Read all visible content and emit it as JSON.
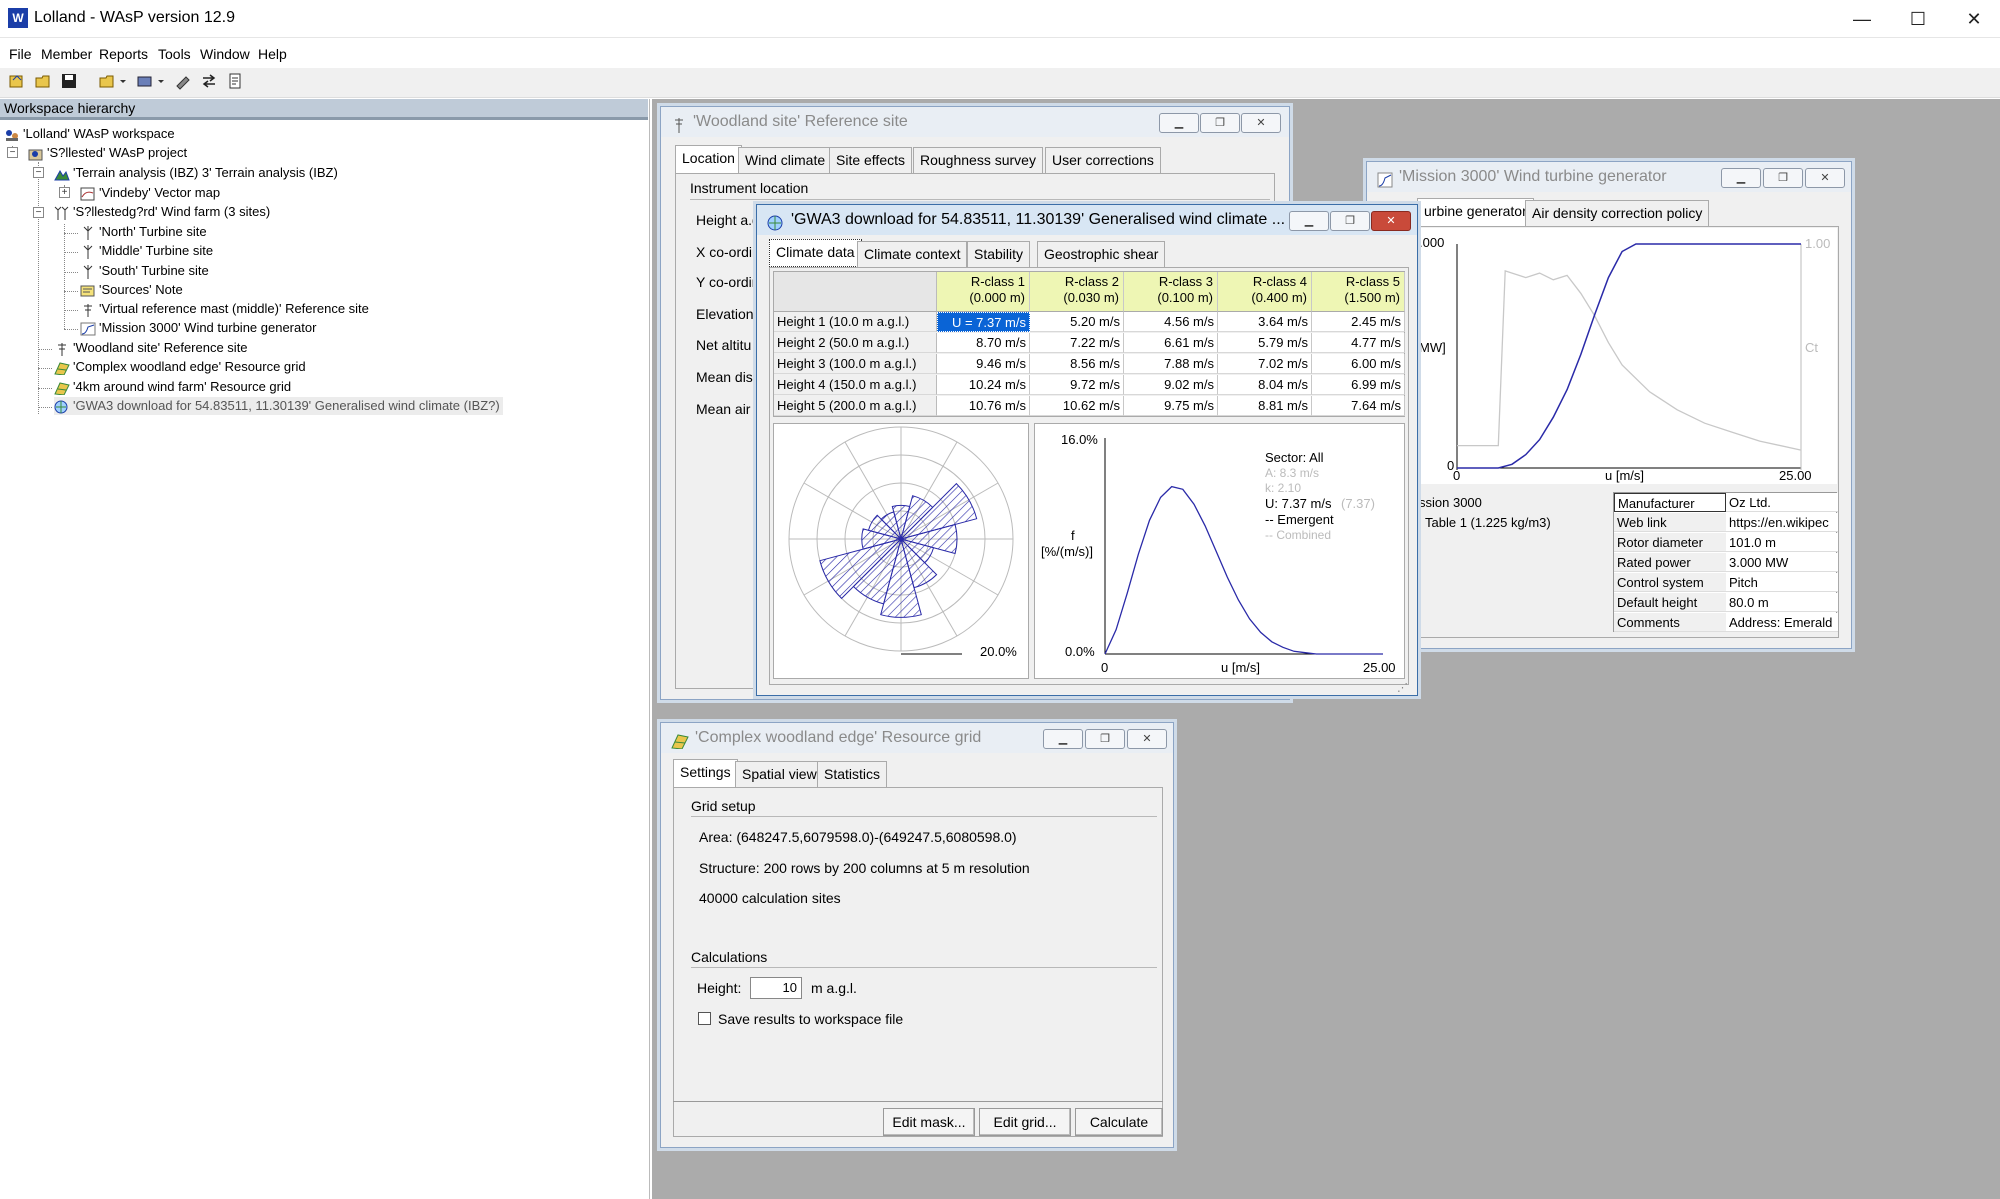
{
  "app": {
    "title": "Lolland - WAsP version 12.9",
    "minimize_glyph": "—",
    "maximize_glyph": "☐",
    "close_glyph": "✕"
  },
  "menu": [
    "File",
    "Member",
    "Reports",
    "Tools",
    "Window",
    "Help"
  ],
  "toolbar": {
    "icons": [
      "new-workspace-icon",
      "open-workspace-icon",
      "save-icon",
      "open-member-icon",
      "insert-member-icon",
      "tools-icon",
      "transfer-icon",
      "report-icon"
    ]
  },
  "workspace": {
    "header": "Workspace hierarchy",
    "items": [
      {
        "label": "'Lolland' WAsP workspace",
        "icon": "workspace-icon"
      },
      {
        "label": "'S?llested' WAsP project",
        "icon": "project-icon"
      },
      {
        "label": "'Terrain analysis (IBZ) 3' Terrain analysis (IBZ)",
        "icon": "terrain-icon"
      },
      {
        "label": "'Vindeby' Vector map",
        "icon": "vector-map-icon"
      },
      {
        "label": "'S?llestedg?rd' Wind farm (3 sites)",
        "icon": "wind-farm-icon"
      },
      {
        "label": "'North' Turbine site",
        "icon": "turbine-site-icon"
      },
      {
        "label": "'Middle' Turbine site",
        "icon": "turbine-site-icon"
      },
      {
        "label": "'South' Turbine site",
        "icon": "turbine-site-icon"
      },
      {
        "label": "'Sources' Note",
        "icon": "note-icon"
      },
      {
        "label": "'Virtual reference mast (middle)' Reference site",
        "icon": "reference-site-icon"
      },
      {
        "label": "'Mission 3000' Wind turbine generator",
        "icon": "wind-turbine-generator-icon"
      },
      {
        "label": "'Woodland site' Reference site",
        "icon": "reference-site-icon"
      },
      {
        "label": "'Complex woodland edge' Resource grid",
        "icon": "resource-grid-icon"
      },
      {
        "label": "'4km around wind farm' Resource grid",
        "icon": "resource-grid-icon"
      },
      {
        "label": "'GWA3 download for 54.83511, 11.30139' Generalised wind climate (IBZ?)",
        "icon": "generalised-wind-climate-icon"
      }
    ]
  },
  "woodland_window": {
    "title": "'Woodland site' Reference site",
    "tabs": [
      "Location",
      "Wind climate",
      "Site effects",
      "Roughness survey",
      "User corrections"
    ],
    "section": "Instrument location",
    "fields": [
      "Height a.g",
      "X co-ordin",
      "Y co-ordin",
      "Elevation",
      "Net altitu",
      "Mean disp",
      "Mean air d"
    ]
  },
  "mission_window": {
    "title": "'Mission 3000' Wind turbine generator",
    "tabs": [
      "urbine generator",
      "Air density correction policy"
    ],
    "chart_labels": {
      "y_top": ".000",
      "y_mid": "MW]",
      "y_zero": "0",
      "x_min": "0",
      "x_label": "u [m/s]",
      "x_max": "25.00",
      "right_top": "1.00",
      "right_mid": "Ct"
    },
    "info_lines": [
      "ssion 3000",
      "Table 1 (1.225 kg/m3)"
    ],
    "properties": [
      {
        "name": "Manufacturer",
        "value": "Oz Ltd."
      },
      {
        "name": "Web link",
        "value": "https://en.wikipec"
      },
      {
        "name": "Rotor diameter",
        "value": "101.0 m"
      },
      {
        "name": "Rated power",
        "value": "3.000 MW"
      },
      {
        "name": "Control system",
        "value": "Pitch"
      },
      {
        "name": "Default height",
        "value": "80.0 m"
      },
      {
        "name": "Comments",
        "value": "Address: Emerald"
      }
    ]
  },
  "gwa_window": {
    "title": "'GWA3 download for 54.83511, 11.30139' Generalised wind climate ...",
    "tabs": [
      "Climate data",
      "Climate context",
      "Stability",
      "Geostrophic shear"
    ],
    "columns": [
      {
        "name": "R-class 1",
        "sub": "(0.000 m)"
      },
      {
        "name": "R-class 2",
        "sub": "(0.030 m)"
      },
      {
        "name": "R-class 3",
        "sub": "(0.100 m)"
      },
      {
        "name": "R-class 4",
        "sub": "(0.400 m)"
      },
      {
        "name": "R-class 5",
        "sub": "(1.500 m)"
      }
    ],
    "rows": [
      {
        "label": "Height 1  (10.0 m a.g.l.)",
        "values": [
          "U = 7.37 m/s",
          "5.20 m/s",
          "4.56 m/s",
          "3.64 m/s",
          "2.45 m/s"
        ]
      },
      {
        "label": "Height 2  (50.0 m a.g.l.)",
        "values": [
          "8.70 m/s",
          "7.22 m/s",
          "6.61 m/s",
          "5.79 m/s",
          "4.77 m/s"
        ]
      },
      {
        "label": "Height 3  (100.0 m a.g.l.)",
        "values": [
          "9.46 m/s",
          "8.56 m/s",
          "7.88 m/s",
          "7.02 m/s",
          "6.00 m/s"
        ]
      },
      {
        "label": "Height 4  (150.0 m a.g.l.)",
        "values": [
          "10.24 m/s",
          "9.72 m/s",
          "9.02 m/s",
          "8.04 m/s",
          "6.99 m/s"
        ]
      },
      {
        "label": "Height 5  (200.0 m a.g.l.)",
        "values": [
          "10.76 m/s",
          "10.62 m/s",
          "9.75 m/s",
          "8.81 m/s",
          "7.64 m/s"
        ]
      }
    ],
    "rose": {
      "scale_label": "20.0%",
      "sector_values": [
        6,
        8,
        14,
        10,
        6,
        9,
        14,
        12,
        15,
        7,
        6,
        5
      ]
    },
    "dist": {
      "y_max": "16.0%",
      "y_min": "0.0%",
      "x_min": "0",
      "x_max": "25.00",
      "x_label": "u [m/s]",
      "y_label_1": "f",
      "y_label_2": "[%/(m/s)]",
      "sector": "Sector: All",
      "A": "A: 8.3 m/s",
      "k": "k: 2.10",
      "U": "U: 7.37 m/s",
      "U_paren": "(7.37)",
      "emergent": "-- Emergent",
      "combined": "-- Combined"
    }
  },
  "chart_data": [
    {
      "type": "line",
      "title": "",
      "xlabel": "u [m/s]",
      "ylabel": "f [%/(m/s)]",
      "xlim": [
        0,
        25
      ],
      "ylim": [
        0,
        16
      ],
      "series": [
        {
          "name": "Emergent",
          "x": [
            0,
            1,
            2,
            3,
            4,
            5,
            6,
            7,
            8,
            9,
            10,
            11,
            12,
            13,
            14,
            15,
            16,
            17,
            18,
            19,
            20,
            21,
            22,
            23,
            24,
            25
          ],
          "values": [
            0,
            1.8,
            4.5,
            7.4,
            9.9,
            11.6,
            12.4,
            12.2,
            11.1,
            9.5,
            7.6,
            5.7,
            4.0,
            2.6,
            1.6,
            0.9,
            0.5,
            0.2,
            0.1,
            0,
            0,
            0,
            0,
            0,
            0,
            0
          ]
        }
      ]
    },
    {
      "type": "line",
      "title": "",
      "xlabel": "u [m/s]",
      "ylabel": "MW",
      "xlim": [
        0,
        25
      ],
      "series": [
        {
          "name": "",
          "x": [
            0,
            3,
            4,
            5,
            6,
            7,
            8,
            9,
            10,
            11,
            12,
            13,
            14,
            25
          ],
          "values": [
            0,
            0,
            0.05,
            0.18,
            0.38,
            0.68,
            1.05,
            1.52,
            2.05,
            2.55,
            2.9,
            3.0,
            3.0,
            3.0
          ]
        },
        {
          "name": "Ct",
          "x": [
            0,
            3,
            3.5,
            5,
            6,
            7,
            8,
            9,
            10,
            11,
            12,
            14,
            16,
            18,
            20,
            22,
            25
          ],
          "values": [
            0.1,
            0.1,
            0.88,
            0.85,
            0.87,
            0.84,
            0.86,
            0.78,
            0.68,
            0.56,
            0.46,
            0.34,
            0.26,
            0.2,
            0.16,
            0.12,
            0.08
          ]
        }
      ]
    },
    {
      "type": "rose",
      "title": "",
      "sectors": 12,
      "values": [
        6,
        8,
        14,
        10,
        6,
        9,
        14,
        12,
        15,
        7,
        6,
        5
      ],
      "scale": "20.0%"
    }
  ],
  "resource_window": {
    "title": "'Complex woodland edge' Resource grid",
    "tabs": [
      "Settings",
      "Spatial view",
      "Statistics"
    ],
    "grid_setup": "Grid setup",
    "area": "Area: (648247.5,6079598.0)-(649247.5,6080598.0)",
    "structure": "Structure: 200 rows by 200 columns at 5 m resolution",
    "sites": "40000 calculation sites",
    "calculations": "Calculations",
    "height_label": "Height:",
    "height_value": "10",
    "height_unit": "m a.g.l.",
    "save_label": "Save results to workspace file",
    "buttons": [
      "Edit mask...",
      "Edit grid...",
      "Calculate"
    ]
  }
}
